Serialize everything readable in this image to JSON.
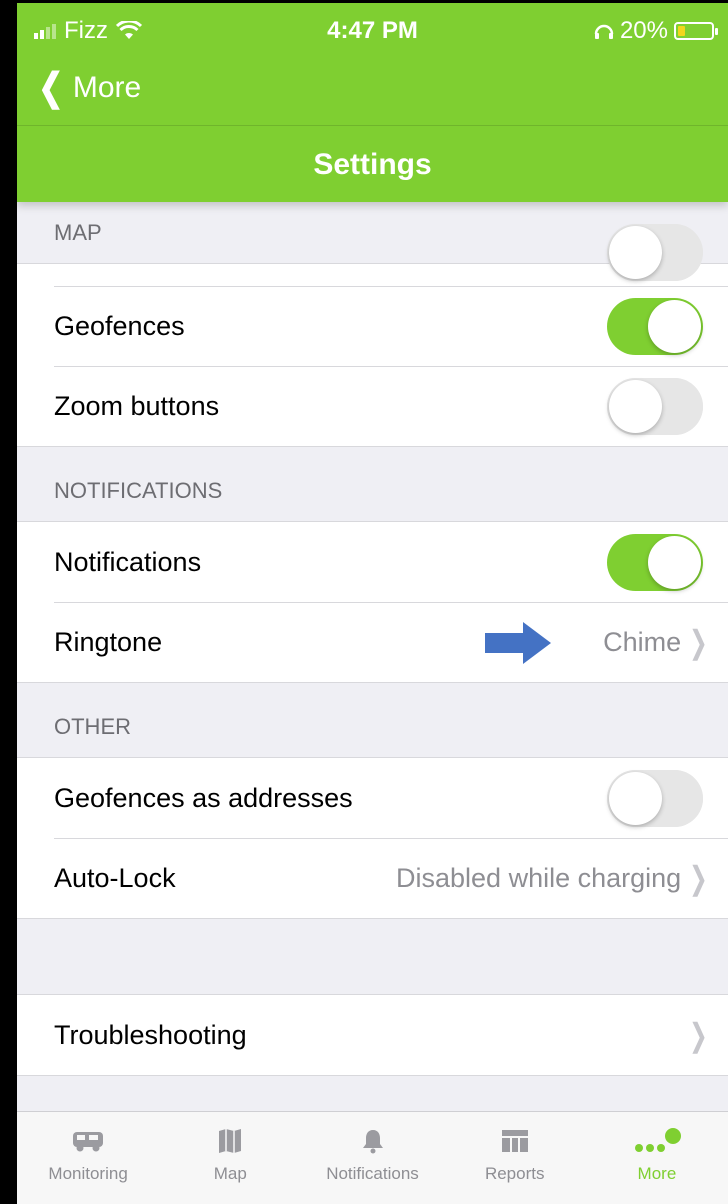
{
  "status_bar": {
    "carrier": "Fizz",
    "time": "4:47 PM",
    "battery_percent": "20%"
  },
  "nav": {
    "back_label": "More",
    "title": "Settings"
  },
  "sections": {
    "map": {
      "header": "MAP",
      "geofences": {
        "label": "Geofences",
        "enabled": true
      },
      "zoom_buttons": {
        "label": "Zoom buttons",
        "enabled": false
      }
    },
    "notifications": {
      "header": "NOTIFICATIONS",
      "notifications": {
        "label": "Notifications",
        "enabled": true
      },
      "ringtone": {
        "label": "Ringtone",
        "value": "Chime"
      }
    },
    "other": {
      "header": "OTHER",
      "geofences_as_addresses": {
        "label": "Geofences as addresses",
        "enabled": false
      },
      "auto_lock": {
        "label": "Auto-Lock",
        "value": "Disabled while charging"
      }
    },
    "support": {
      "troubleshooting": {
        "label": "Troubleshooting"
      }
    }
  },
  "tabbar": [
    {
      "label": "Monitoring",
      "icon": "van-icon"
    },
    {
      "label": "Map",
      "icon": "map-icon"
    },
    {
      "label": "Notifications",
      "icon": "bell-icon"
    },
    {
      "label": "Reports",
      "icon": "table-icon"
    },
    {
      "label": "More",
      "icon": "more-dots-icon",
      "active": true
    }
  ],
  "colors": {
    "accent_green": "#7fcf31",
    "annotation_arrow": "#4472c4"
  }
}
